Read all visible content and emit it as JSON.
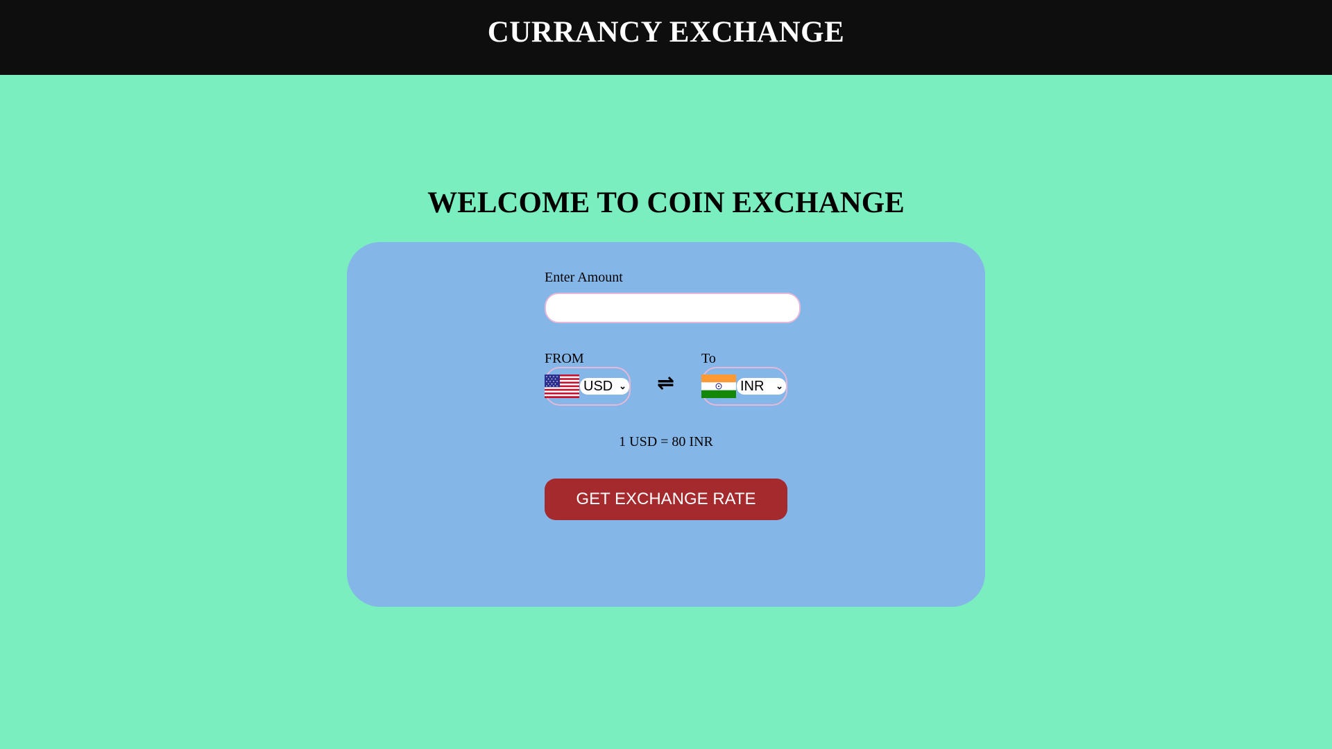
{
  "header": {
    "title": "CURRANCY EXCHANGE"
  },
  "main": {
    "welcome_title": "WELCOME TO COIN EXCHANGE",
    "amount_label": "Enter Amount",
    "amount_value": "",
    "from_label": "FROM",
    "from_currency": "USD",
    "from_flag": "us-flag",
    "swap_icon": "⇌",
    "to_label": "To",
    "to_currency": "INR",
    "to_flag": "india-flag",
    "rate_text": "1 USD = 80 INR",
    "button_label": "GET EXCHANGE RATE"
  },
  "colors": {
    "page_bg": "#7beec0",
    "header_bg": "#0e0e0e",
    "card_bg": "#84b6e8",
    "button_bg": "#a52a2d"
  }
}
